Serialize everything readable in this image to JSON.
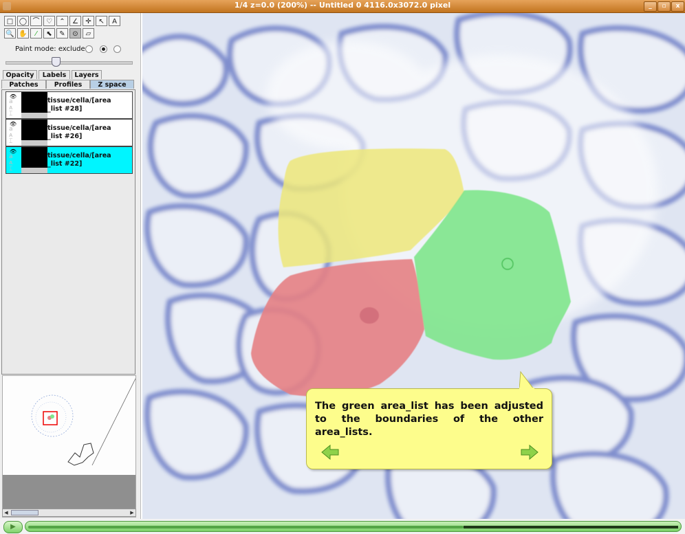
{
  "window": {
    "title": "1/4 z=0.0 (200%) -- Untitled 0  4116.0x3072.0 pixel",
    "buttons": {
      "minimize": "_",
      "maximize": "▫",
      "close": "x"
    }
  },
  "toolbar": {
    "row1": [
      "□",
      "◯",
      "⌒",
      "♡",
      "⌃",
      "∠",
      "✛",
      "↖",
      "A"
    ],
    "row2": [
      "🔍",
      "✋",
      "⁄",
      "⬉",
      "✎",
      "⊙",
      "▱"
    ]
  },
  "paint_mode": {
    "label": "Paint mode: exclude",
    "selected_index": 1
  },
  "tabs_row1": [
    "Opacity",
    "Labels",
    "Layers"
  ],
  "tabs_row2": [
    "Patches",
    "Profiles",
    "Z space"
  ],
  "active_tab": "Z space",
  "layers": [
    {
      "name": "tissue/cella/[area_list #28]",
      "line1": "tissue/cella/[area",
      "line2": "_list #28]",
      "selected": false
    },
    {
      "name": "tissue/cella/[area_list #26]",
      "line1": "tissue/cella/[area",
      "line2": "_list #26]",
      "selected": false
    },
    {
      "name": "tissue/cella/[area_list #22]",
      "line1": "tissue/cella/[area",
      "line2": "_list #22]",
      "selected": true
    }
  ],
  "area_list_colors": {
    "yellow": "#ede87a",
    "red": "#e58184",
    "green": "#7fe58c"
  },
  "tooltip": {
    "text": "The green area_list has been adjusted to the boundaries of the other area_lists."
  },
  "player": {
    "progress": 0.67
  }
}
